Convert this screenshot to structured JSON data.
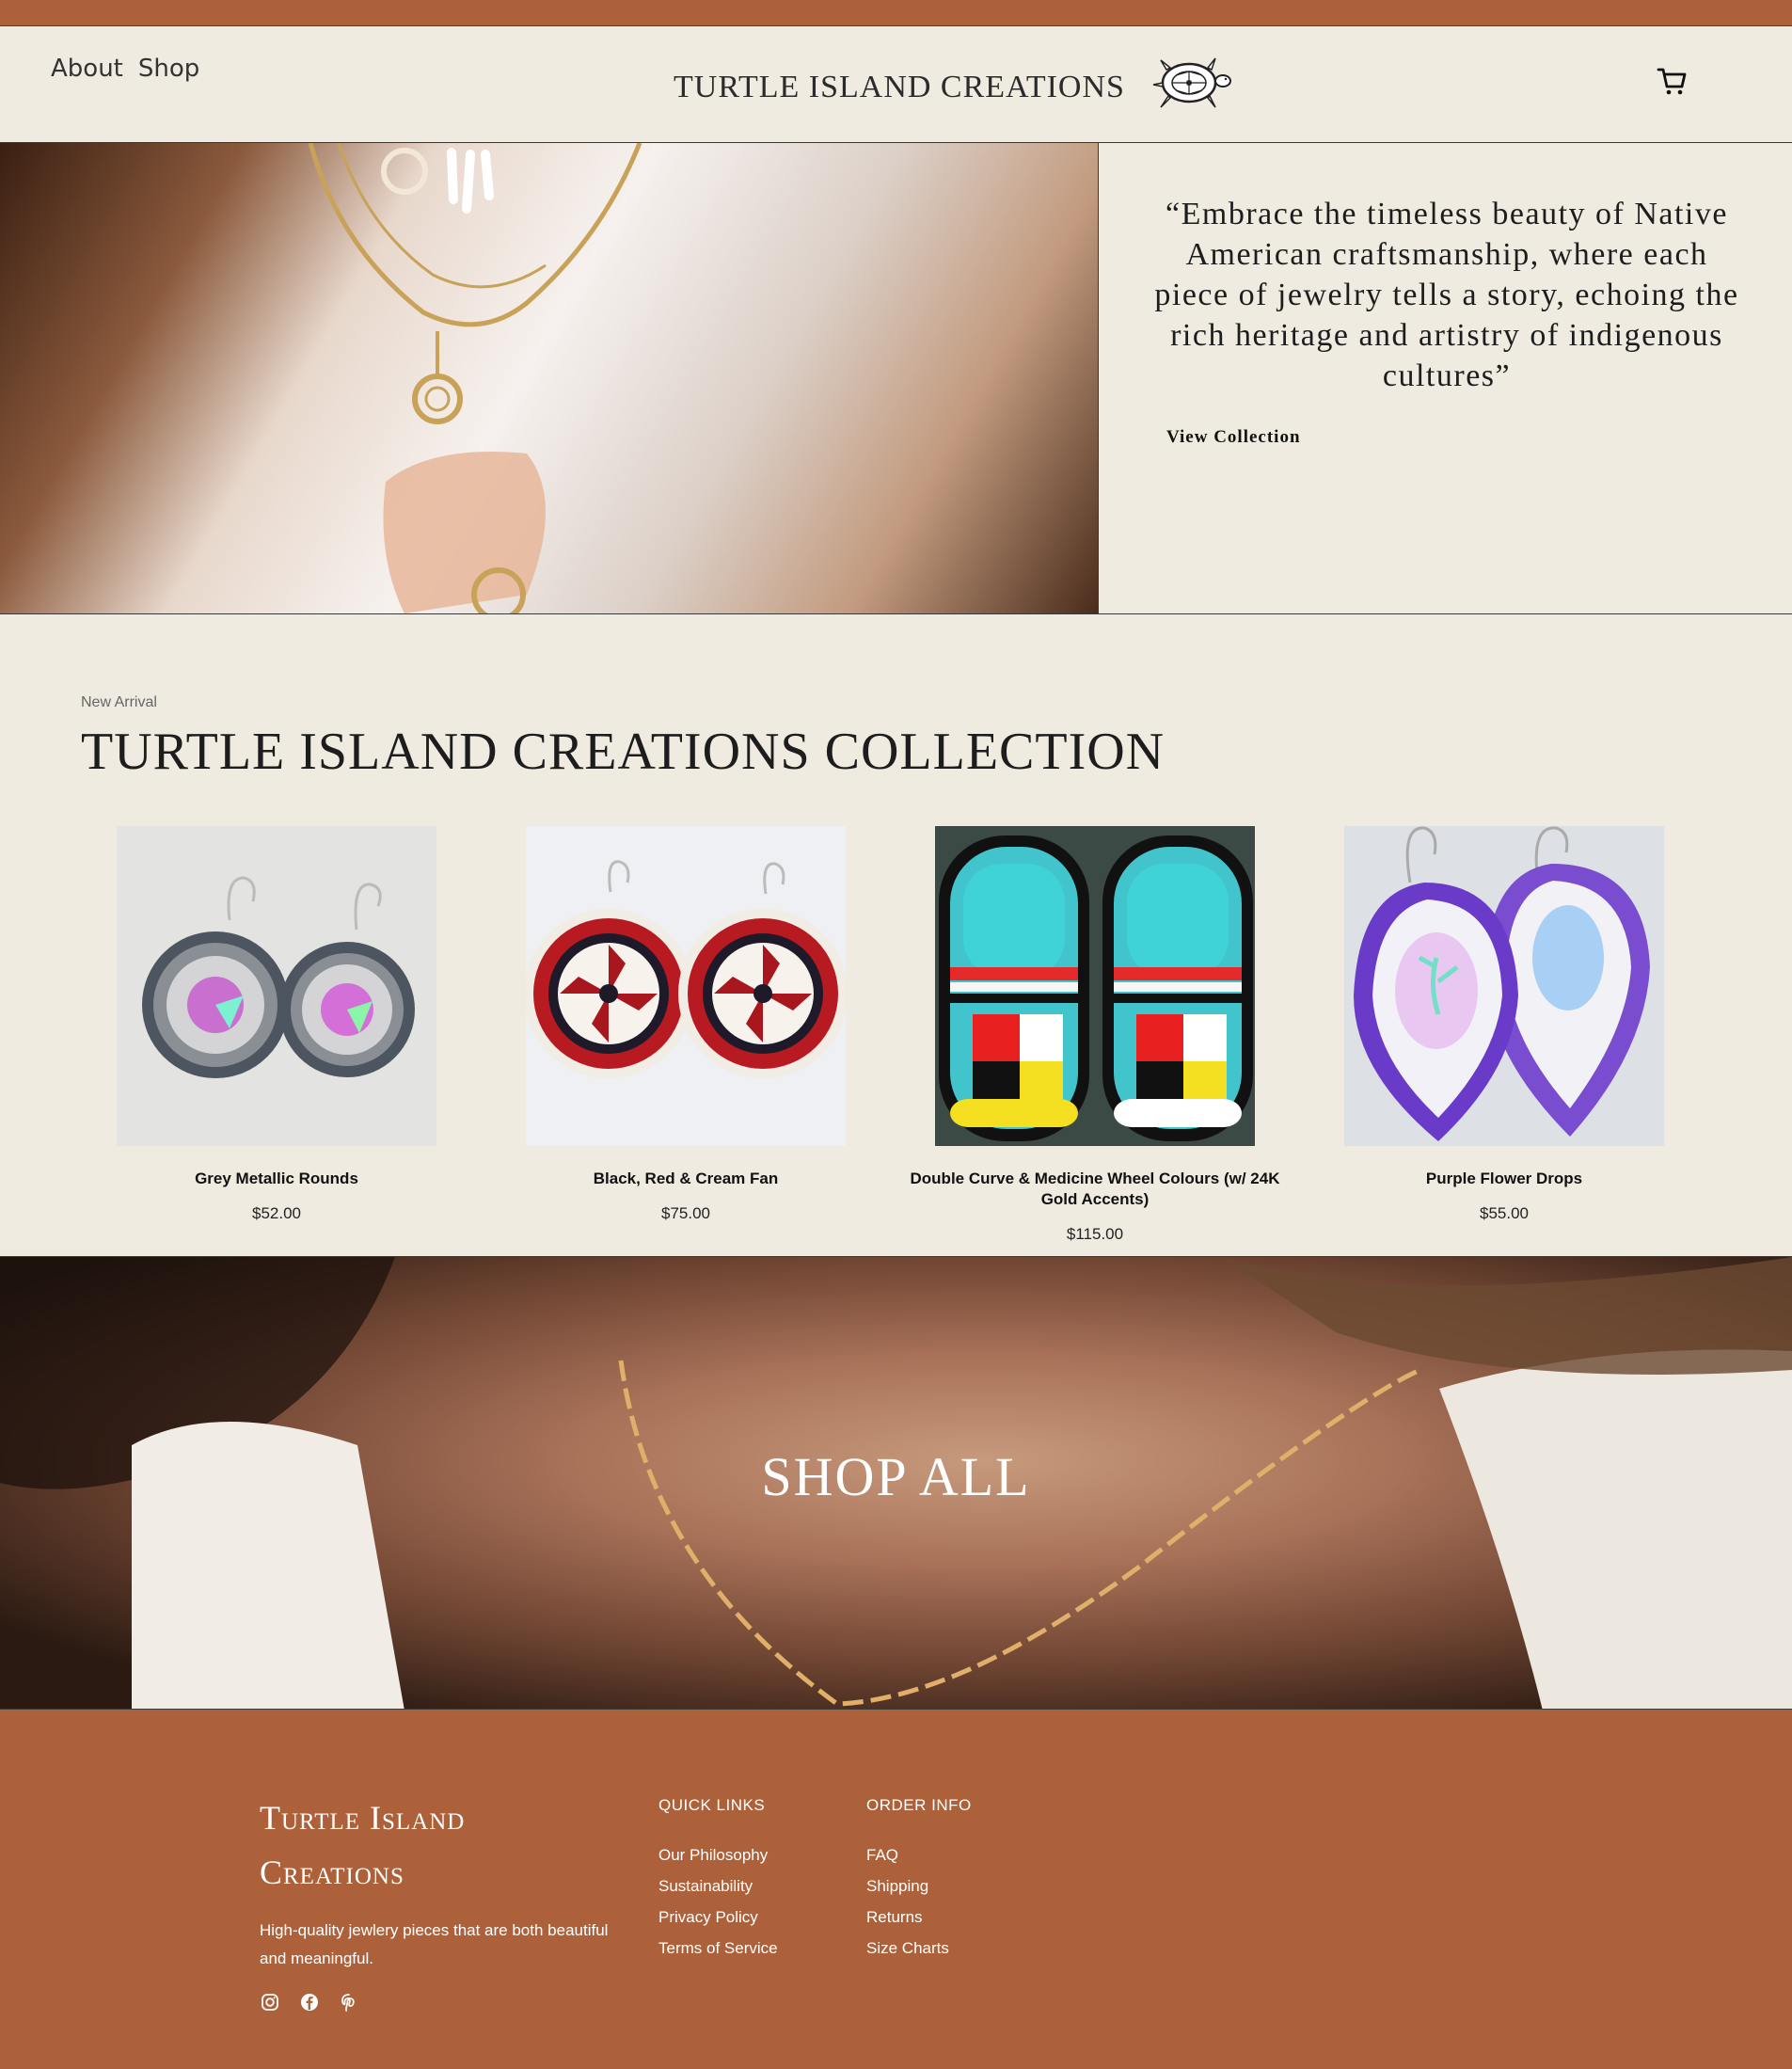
{
  "nav": {
    "about": "About",
    "shop": "Shop"
  },
  "brand": {
    "name": "TURTLE ISLAND CREATIONS"
  },
  "hero": {
    "quote": "“Embrace the timeless beauty of Native American craftsmanship, where each piece of jewelry tells a story, echoing the rich heritage and artistry of indigenous cultures”",
    "cta": "View Collection"
  },
  "collection": {
    "eyebrow": "New Arrival",
    "title": "TURTLE ISLAND CREATIONS COLLECTION",
    "products": [
      {
        "name": "Grey Metallic Rounds",
        "price": "$52.00"
      },
      {
        "name": "Black, Red & Cream Fan",
        "price": "$75.00"
      },
      {
        "name": "Double Curve & Medicine Wheel Colours (w/ 24K Gold Accents)",
        "price": "$115.00"
      },
      {
        "name": "Purple Flower Drops",
        "price": "$55.00"
      }
    ]
  },
  "shopall": {
    "label": "SHOP ALL"
  },
  "footer": {
    "brand": "Turtle Island Creations",
    "tagline": "High-quality jewlery pieces that are both beautiful and meaningful.",
    "quick_links": {
      "heading": "QUICK LINKS",
      "items": [
        "Our Philosophy",
        "Sustainability",
        "Privacy Policy",
        "Terms of Service"
      ]
    },
    "order_info": {
      "heading": "ORDER INFO",
      "items": [
        "FAQ",
        "Shipping",
        "Returns",
        "Size Charts"
      ]
    },
    "social_icons": [
      "instagram-icon",
      "facebook-icon",
      "pinterest-icon"
    ]
  }
}
